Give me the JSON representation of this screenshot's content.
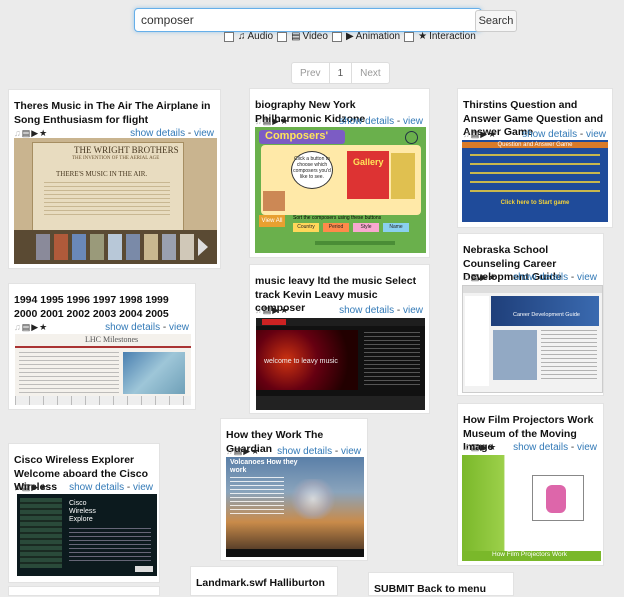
{
  "search": {
    "value": "composer",
    "button": "Search"
  },
  "filters": [
    {
      "icon": "♫",
      "label": "Audio"
    },
    {
      "icon": "▤",
      "label": "Video"
    },
    {
      "icon": "▶",
      "label": "Animation"
    },
    {
      "icon": "★",
      "label": "Interaction"
    }
  ],
  "pagination": {
    "prev": "Prev",
    "page": "1",
    "next": "Next"
  },
  "links": {
    "show": "show details",
    "sep": " - ",
    "view": "view"
  },
  "cards": [
    {
      "title": "Theres Music in The Air The Airplane in Song Enthusiasm for flight",
      "thumb": {
        "brand": "THE WRIGHT BROTHERS",
        "sub": "THE INVENTION OF THE AERIAL AGE",
        "head": "THERE'S MUSIC IN THE AIR."
      }
    },
    {
      "title": "1994 1995 1996 1997 1998 1999 2000 2001 2002 2003 2004 2005",
      "thumb": {
        "brand": "LHC Milestones"
      }
    },
    {
      "title": "Cisco Wireless Explorer Welcome aboard the Cisco Wireless",
      "thumb": {
        "brand": "Cisco Wireless Explore"
      }
    },
    {
      "title": "biography New York Philharmonic Kidzone",
      "thumb": {
        "brand": "Composers'",
        "gallery": "Gallery",
        "bubble": "Click a button to choose which composers you'd like to see.",
        "sort": "Sort the composers using these buttons",
        "btn_all": "View All",
        "btn_country": "Country",
        "btn_period": "Period",
        "btn_style": "Style",
        "btn_name": "Name"
      }
    },
    {
      "title": "music leavy ltd the music Select track Kevin Leavy music composer",
      "thumb": {
        "brand": "welcome to leavy music"
      }
    },
    {
      "title": "How they Work The Guardian",
      "thumb": {
        "brand": "Volcanoes How they work"
      }
    },
    {
      "title": "Landmark.swf Halliburton"
    },
    {
      "title": "Thirstins Question and Answer Game Question and Answer Game",
      "thumb": {
        "brand": "Question and Answer Game",
        "start": "Click here to Start game"
      }
    },
    {
      "title": "Nebraska School Counseling Career Development Guide",
      "thumb": {
        "brand": "Career Development Guide"
      }
    },
    {
      "title": "How Film Projectors Work Museum of the Moving Image",
      "thumb": {
        "brand": "How Film Projectors Work"
      }
    },
    {
      "title": "SUBMIT Back to menu"
    }
  ]
}
